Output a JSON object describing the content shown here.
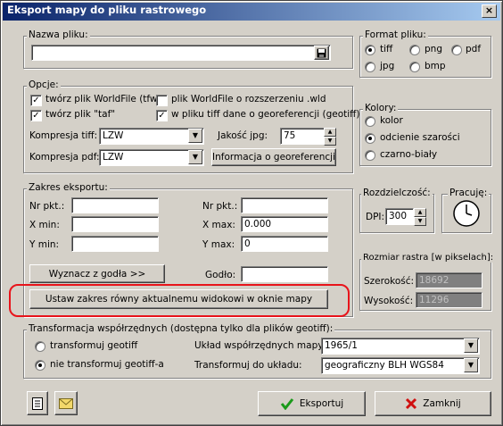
{
  "window": {
    "title": "Eksport mapy do pliku rastrowego",
    "close_label": "×"
  },
  "filename": {
    "group_label": "Nazwa pliku:",
    "value": ""
  },
  "format": {
    "group_label": "Format pliku:",
    "options": [
      {
        "label": "tiff",
        "selected": true
      },
      {
        "label": "png",
        "selected": false
      },
      {
        "label": "pdf",
        "selected": false
      },
      {
        "label": "jpg",
        "selected": false
      },
      {
        "label": "bmp",
        "selected": false
      }
    ]
  },
  "options": {
    "group_label": "Opcje:",
    "worldfile": {
      "label": "twórz plik WorldFile (tfw)",
      "checked": true
    },
    "worldfile_wld": {
      "label": "plik WorldFile o rozszerzeniu .wld",
      "checked": false
    },
    "taf": {
      "label": "twórz plik \"taf\"",
      "checked": true
    },
    "geotiff": {
      "label": "w pliku tiff dane o georeferencji (geotiff)",
      "checked": true
    },
    "tiff_compression": {
      "label": "Kompresja tiff:",
      "value": "LZW"
    },
    "pdf_compression": {
      "label": "Kompresja pdf:",
      "value": "LZW"
    },
    "jpg_quality": {
      "label": "Jakość jpg:",
      "value": "75"
    },
    "georef_info_button": "Informacja o georeferencji"
  },
  "colors": {
    "group_label": "Kolory:",
    "options": [
      {
        "label": "kolor",
        "selected": false
      },
      {
        "label": "odcienie szarości",
        "selected": true
      },
      {
        "label": "czarno-biały",
        "selected": false
      }
    ]
  },
  "extent": {
    "group_label": "Zakres eksportu:",
    "nr1_label": "Nr pkt.:",
    "nr1_value": "",
    "xmin_label": "X min:",
    "xmin_value": "",
    "ymin_label": "Y min:",
    "ymin_value": "",
    "nr2_label": "Nr pkt.:",
    "nr2_value": "",
    "xmax_label": "X max:",
    "xmax_value": "0.000",
    "ymax_label": "Y max:",
    "ymax_value": "0",
    "from_godlo_button": "Wyznacz z godła >>",
    "godlo_label": "Godło:",
    "godlo_value": "",
    "set_view_button": "Ustaw zakres równy aktualnemu widokowi w oknie mapy"
  },
  "resolution": {
    "group_label": "Rozdzielczość:",
    "dpi_label": "DPI:",
    "dpi_value": "300"
  },
  "work": {
    "group_label": "Pracuję:"
  },
  "raster_size": {
    "group_label": "Rozmiar rastra [w pikselach]:",
    "width_label": "Szerokość:",
    "width_value": "18692",
    "height_label": "Wysokość:",
    "height_value": "11296"
  },
  "transform": {
    "group_label": "Transformacja współrzędnych (dostępna tylko dla plików geotiff):",
    "opt_transform": {
      "label": "transformuj geotiff",
      "selected": false
    },
    "opt_no_transform": {
      "label": "nie transformuj geotiff-a",
      "selected": true
    },
    "coord_system_label": "Układ współrzędnych mapy:",
    "coord_system_value": "1965/1",
    "target_label": "Transformuj do układu:",
    "target_value": "geograficzny BLH WGS84"
  },
  "footer": {
    "export_button": "Eksportuj",
    "close_button": "Zamknij"
  },
  "highlight_color": "#e8141b"
}
